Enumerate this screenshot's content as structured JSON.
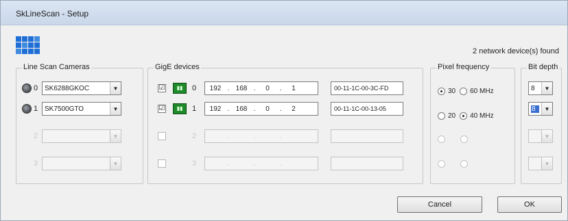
{
  "window": {
    "title": "SkLineScan - Setup"
  },
  "header": {
    "devices_found": "2  network device(s) found"
  },
  "line_scan": {
    "label": "Line Scan Cameras",
    "rows": [
      {
        "index": "0",
        "value": "SK6288GKOC"
      },
      {
        "index": "1",
        "value": "SK7500GTO"
      },
      {
        "index": "2",
        "value": ""
      },
      {
        "index": "3",
        "value": ""
      }
    ]
  },
  "gige": {
    "label": "GigE devices",
    "rows": [
      {
        "checked": "☑",
        "index": "0",
        "ip": [
          "192",
          "168",
          "0",
          "1"
        ],
        "mac": "00-11-1C-00-3C-FD"
      },
      {
        "checked": "☑",
        "index": "1",
        "ip": [
          "192",
          "168",
          "0",
          "2"
        ],
        "mac": "00-11-1C-00-13-05"
      },
      {
        "checked": "",
        "index": "2",
        "ip": [
          "",
          "",
          "",
          ""
        ],
        "mac": ""
      },
      {
        "checked": "",
        "index": "3",
        "ip": [
          "",
          "",
          "",
          ""
        ],
        "mac": ""
      }
    ]
  },
  "pixel_frequency": {
    "label": "Pixel frequency",
    "rows": [
      {
        "a": "30",
        "b": "60 MHz",
        "selected": "a"
      },
      {
        "a": "20",
        "b": "40 MHz",
        "selected": "b"
      },
      {
        "a": "",
        "b": "",
        "selected": ""
      },
      {
        "a": "",
        "b": "",
        "selected": ""
      }
    ]
  },
  "bit_depth": {
    "label": "Bit depth",
    "rows": [
      "8",
      "8",
      "",
      ""
    ]
  },
  "buttons": {
    "cancel": "Cancel",
    "ok": "OK"
  },
  "colors": {
    "titlebar": "#c9d7ea",
    "chip": "#1f8a2a",
    "logo": "#1f6fd6"
  }
}
